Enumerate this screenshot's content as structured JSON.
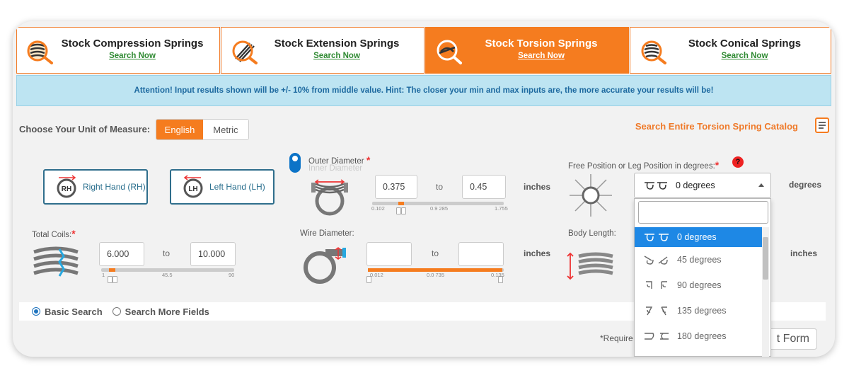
{
  "tabs": [
    {
      "title": "Stock Compression Springs",
      "link": "Search Now",
      "icon": "compression-spring-icon"
    },
    {
      "title": "Stock Extension Springs",
      "link": "Search Now",
      "icon": "extension-spring-icon"
    },
    {
      "title": "Stock Torsion Springs",
      "link": "Search Now",
      "icon": "torsion-spring-icon"
    },
    {
      "title": "Stock Conical Springs",
      "link": "Search Now",
      "icon": "conical-spring-icon"
    }
  ],
  "alert": "Attention! Input results shown will be +/- 10% from middle value. Hint: The closer your min and max inputs are, the more accurate your results will be!",
  "unit": {
    "label": "Choose Your Unit of Measure:",
    "options": [
      "English",
      "Metric"
    ]
  },
  "catalog_link": "Search Entire Torsion Spring Catalog",
  "hand": {
    "rh_label": "Right Hand (RH)",
    "lh_label": "Left Hand (LH)",
    "rh_badge": "RH",
    "lh_badge": "LH"
  },
  "outer_diameter": {
    "label": "Outer Diameter",
    "alt_label": "Inner Diameter",
    "min": "0.375",
    "max": "0.45",
    "to": "to",
    "units": "inches",
    "ticks": [
      "0.102",
      "0.9 285",
      "1.755"
    ]
  },
  "free_position": {
    "label": "Free Position or Leg Position in degrees:",
    "selected": "0 degrees",
    "units": "degrees",
    "help": "?",
    "options": [
      "0 degrees",
      "45 degrees",
      "90 degrees",
      "135 degrees",
      "180 degrees"
    ]
  },
  "total_coils": {
    "label": "Total Coils:",
    "min": "6.000",
    "max": "10.000",
    "to": "to",
    "ticks": [
      "1",
      "45.5",
      "90"
    ]
  },
  "wire_diameter": {
    "label": "Wire Diameter:",
    "min": "",
    "max": "",
    "to": "to",
    "units": "inches",
    "ticks": [
      "0.012",
      "0.0 735",
      "0.135"
    ]
  },
  "body_length": {
    "label": "Body Length:",
    "units": "inches"
  },
  "search_mode": {
    "basic": "Basic Search",
    "more": "Search More Fields"
  },
  "required_note": "*Require",
  "reset_button": "t Form",
  "colors": {
    "accent": "#f57c1f",
    "link_green": "#2f8a32",
    "alert_bg": "#bde4f2",
    "select_blue": "#1e88e5"
  }
}
